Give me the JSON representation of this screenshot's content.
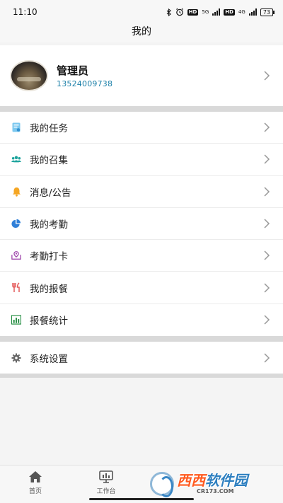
{
  "status_bar": {
    "time": "11:10",
    "network1": "5G",
    "network2": "4G",
    "battery": "73"
  },
  "header": {
    "title": "我的"
  },
  "profile": {
    "name": "管理员",
    "phone": "13524009738"
  },
  "menu_group1": [
    {
      "label": "我的任务",
      "icon": "task-icon",
      "color": "#4fb3e6"
    },
    {
      "label": "我的召集",
      "icon": "group-icon",
      "color": "#1ba39c"
    },
    {
      "label": "消息/公告",
      "icon": "bell-icon",
      "color": "#f5a623"
    },
    {
      "label": "我的考勤",
      "icon": "pie-chart-icon",
      "color": "#2f7fd8"
    },
    {
      "label": "考勤打卡",
      "icon": "location-checkin-icon",
      "color": "#9b3fa8"
    },
    {
      "label": "我的报餐",
      "icon": "cutlery-icon",
      "color": "#e45b5b"
    },
    {
      "label": "报餐统计",
      "icon": "bar-chart-icon",
      "color": "#1e8a3c"
    }
  ],
  "menu_group2": [
    {
      "label": "系统设置",
      "icon": "gear-icon",
      "color": "#666666"
    }
  ],
  "tabbar": {
    "tabs": [
      {
        "label": "首页",
        "icon": "home-icon"
      },
      {
        "label": "工作台",
        "icon": "workbench-icon"
      }
    ]
  },
  "watermark": {
    "main_a": "西西",
    "main_b": "软件园",
    "sub": "CR173.COM"
  }
}
